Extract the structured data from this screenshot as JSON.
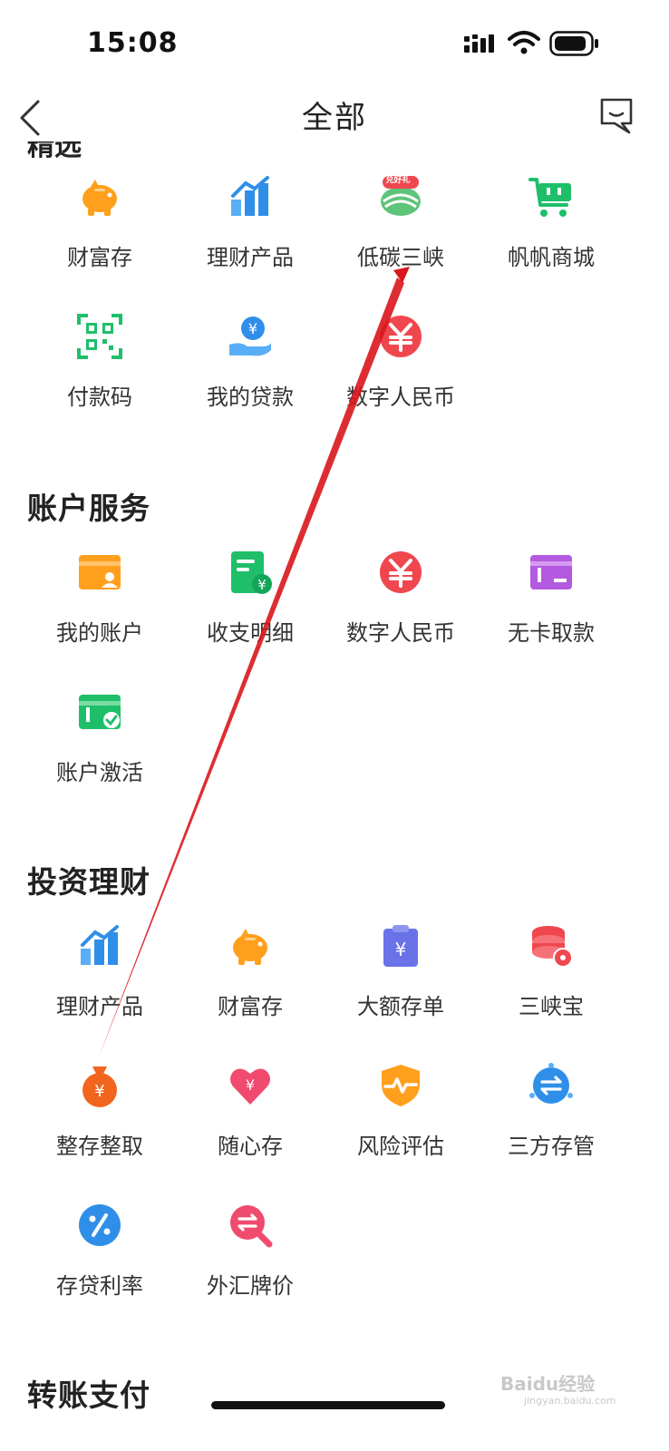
{
  "status_bar": {
    "time": "15:08"
  },
  "nav": {
    "title": "全部"
  },
  "partial_heading": "精选",
  "sections": [
    {
      "title": "",
      "items": [
        {
          "label": "财富存",
          "icon": "piggy-bank-icon"
        },
        {
          "label": "理财产品",
          "icon": "bar-chart-icon"
        },
        {
          "label": "低碳三峡",
          "icon": "gift-redeem-icon"
        },
        {
          "label": "帆帆商城",
          "icon": "shopping-cart-icon"
        },
        {
          "label": "付款码",
          "icon": "qr-code-icon"
        },
        {
          "label": "我的贷款",
          "icon": "loan-hand-icon"
        },
        {
          "label": "数字人民币",
          "icon": "digital-yuan-icon"
        }
      ]
    },
    {
      "title": "账户服务",
      "items": [
        {
          "label": "我的账户",
          "icon": "account-card-icon"
        },
        {
          "label": "收支明细",
          "icon": "transaction-detail-icon"
        },
        {
          "label": "数字人民币",
          "icon": "digital-yuan-icon"
        },
        {
          "label": "无卡取款",
          "icon": "cardless-withdraw-icon"
        },
        {
          "label": "账户激活",
          "icon": "account-activate-icon"
        }
      ]
    },
    {
      "title": "投资理财",
      "items": [
        {
          "label": "理财产品",
          "icon": "bar-chart-icon"
        },
        {
          "label": "财富存",
          "icon": "piggy-bank-icon"
        },
        {
          "label": "大额存单",
          "icon": "deposit-certificate-icon"
        },
        {
          "label": "三峡宝",
          "icon": "coin-stack-icon"
        },
        {
          "label": "整存整取",
          "icon": "money-bag-icon"
        },
        {
          "label": "随心存",
          "icon": "heart-yuan-icon"
        },
        {
          "label": "风险评估",
          "icon": "risk-shield-icon"
        },
        {
          "label": "三方存管",
          "icon": "custody-exchange-icon"
        },
        {
          "label": "存贷利率",
          "icon": "interest-rate-icon"
        },
        {
          "label": "外汇牌价",
          "icon": "forex-search-icon"
        }
      ]
    },
    {
      "title": "转账支付",
      "items": []
    }
  ],
  "gift_badge": "兑好礼",
  "watermark": {
    "brand": "Baidu经验",
    "url": "jingyan.baidu.com"
  },
  "colors": {
    "orange": "#FF9F1C",
    "blue": "#2F8FE8",
    "green": "#1FBF6A",
    "red": "#F0474F",
    "purple": "#B45AE0",
    "pink": "#F04B6E",
    "indigo": "#6A72E8",
    "annotation_arrow": "#D9161C"
  }
}
